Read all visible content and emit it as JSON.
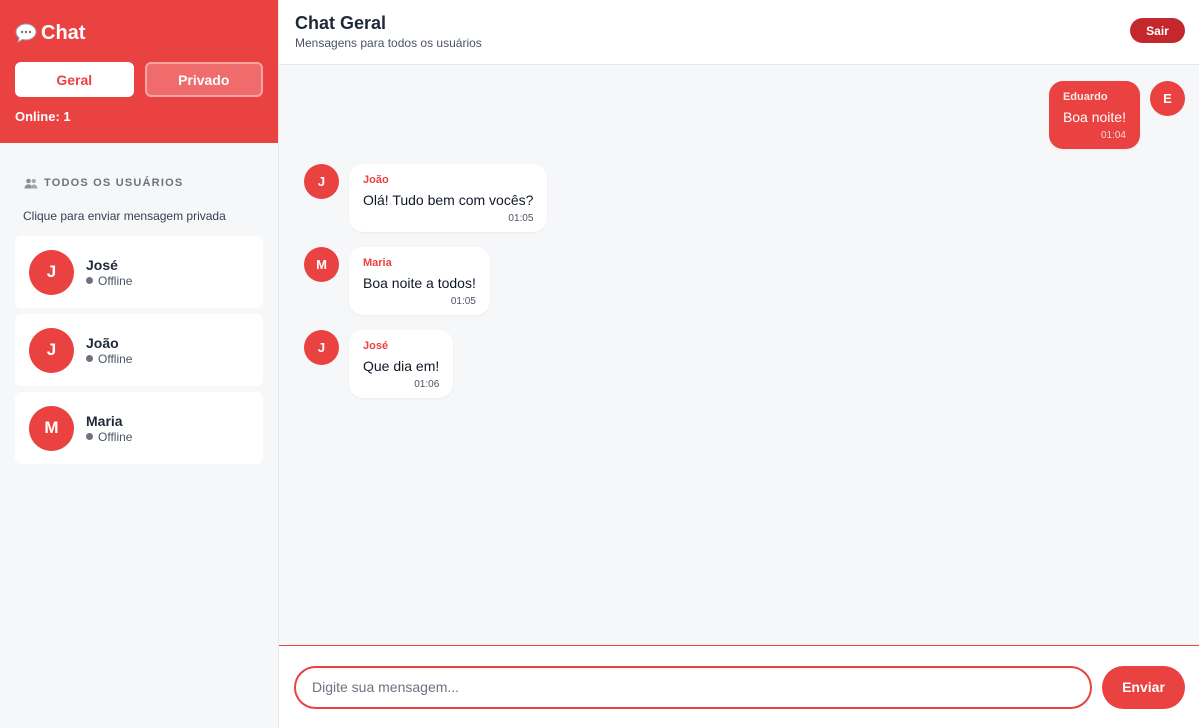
{
  "sidebar": {
    "brand": "Chat",
    "tabs": [
      {
        "label": "Geral",
        "active": true
      },
      {
        "label": "Privado",
        "active": false
      }
    ],
    "online": "Online: 1",
    "section_title": "TODOS OS USUÁRIOS",
    "hint": "Clique para enviar mensagem privada",
    "users": [
      {
        "initial": "J",
        "name": "José",
        "status": "Offline"
      },
      {
        "initial": "J",
        "name": "João",
        "status": "Offline"
      },
      {
        "initial": "M",
        "name": "Maria",
        "status": "Offline"
      }
    ]
  },
  "header": {
    "title": "Chat Geral",
    "subtitle": "Mensagens para todos os usuários",
    "logout_label": "Sair"
  },
  "messages": [
    {
      "own": true,
      "initial": "E",
      "sender": "Eduardo",
      "text": "Boa noite!",
      "time": "01:04"
    },
    {
      "own": false,
      "initial": "J",
      "sender": "João",
      "text": "Olá! Tudo bem com vocês?",
      "time": "01:05"
    },
    {
      "own": false,
      "initial": "M",
      "sender": "Maria",
      "text": "Boa noite a todos!",
      "time": "01:05"
    },
    {
      "own": false,
      "initial": "J",
      "sender": "José",
      "text": "Que dia em!",
      "time": "01:06"
    }
  ],
  "composer": {
    "placeholder": "Digite sua mensagem...",
    "value": "",
    "send_label": "Enviar"
  },
  "colors": {
    "accent": "#ea4141",
    "logout": "#c5282c",
    "background": "#f6f7f9"
  },
  "icons": {
    "brand": "speech-bubble-icon",
    "users_section": "people-icon"
  }
}
